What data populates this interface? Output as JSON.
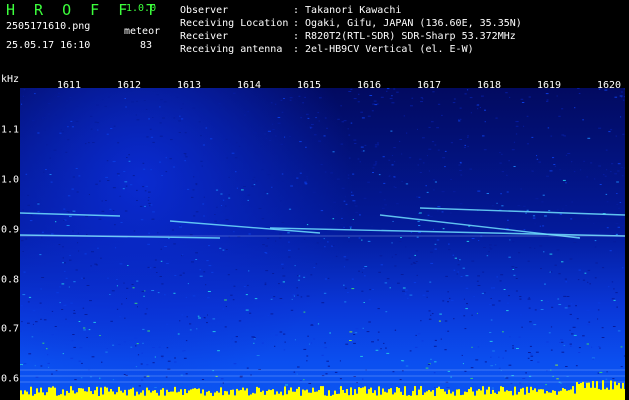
{
  "header": {
    "app_title": "H R O F F T",
    "app_version": "1.0.0",
    "file_name": "2505171610.png",
    "timestamp": "25.05.17 16:10",
    "meteor_label": "meteor",
    "meteor_count": "83"
  },
  "info": {
    "observer_key": "Observer",
    "observer_val": ": Takanori Kawachi",
    "location_key": "Receiving Location",
    "location_val": ": Ogaki, Gifu, JAPAN (136.60E, 35.35N)",
    "receiver_key": "Receiver",
    "receiver_val": ": R820T2(RTL-SDR) SDR-Sharp 53.372MHz",
    "antenna_key": "Receiving antenna",
    "antenna_val": ": 2el-HB9CV Vertical (el. E-W)"
  },
  "axis": {
    "unit": "kHz",
    "x_ticks": [
      "1611",
      "1612",
      "1613",
      "1614",
      "1615",
      "1616",
      "1617",
      "1618",
      "1619",
      "1620"
    ],
    "y_ticks": [
      "1.1",
      "1.0",
      "0.9",
      "0.8",
      "0.7",
      "0.6"
    ]
  },
  "colors": {
    "accent": "#3cff3c",
    "signal": "#ffff00"
  }
}
